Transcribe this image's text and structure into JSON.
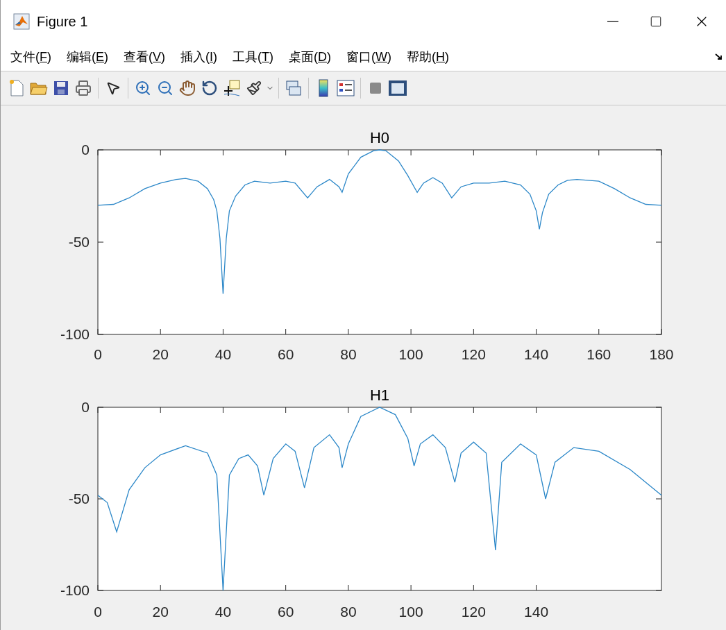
{
  "window": {
    "title": "Figure 1"
  },
  "menu": [
    {
      "label": "文件(",
      "accesskey": "F",
      "close": ")"
    },
    {
      "label": "编辑(",
      "accesskey": "E",
      "close": ")"
    },
    {
      "label": "查看(",
      "accesskey": "V",
      "close": ")"
    },
    {
      "label": "插入(",
      "accesskey": "I",
      "close": ")"
    },
    {
      "label": "工具(",
      "accesskey": "T",
      "close": ")"
    },
    {
      "label": "桌面(",
      "accesskey": "D",
      "close": ")"
    },
    {
      "label": "窗口(",
      "accesskey": "W",
      "close": ")"
    },
    {
      "label": "帮助(",
      "accesskey": "H",
      "close": ")"
    }
  ],
  "plots": [
    {
      "chart_data": {
        "type": "line",
        "title": "H0",
        "xlim": [
          0,
          180
        ],
        "ylim": [
          -100,
          0
        ],
        "xticks": [
          0,
          20,
          40,
          60,
          80,
          100,
          120,
          140,
          160,
          180
        ],
        "yticks": [
          -100,
          -50,
          0
        ],
        "x": [
          0,
          5,
          10,
          15,
          20,
          25,
          28,
          32,
          35,
          37,
          38,
          39,
          40,
          41,
          42,
          44,
          47,
          50,
          55,
          60,
          63,
          67,
          70,
          74,
          77,
          78,
          80,
          84,
          88,
          90,
          92,
          96,
          99,
          102,
          104,
          107,
          110,
          113,
          116,
          120,
          125,
          130,
          135,
          138,
          140,
          141,
          142,
          144,
          147,
          150,
          153,
          160,
          165,
          170,
          175,
          180
        ],
        "series": [
          {
            "color": "#2b87c8",
            "values": [
              -30,
              -29.5,
              -26,
              -21,
              -18,
              -16,
              -15.5,
              -17,
              -21,
              -27,
              -33,
              -48,
              -78,
              -48,
              -33,
              -25,
              -19,
              -17,
              -18,
              -17,
              -18,
              -26,
              -20,
              -16,
              -20,
              -23,
              -13,
              -4,
              -0.5,
              0,
              -0.5,
              -6,
              -14,
              -23,
              -18,
              -15,
              -18,
              -26,
              -20,
              -18,
              -18,
              -17,
              -19,
              -24,
              -33,
              -43,
              -34,
              -24,
              -19,
              -16.5,
              -16,
              -17,
              -21,
              -26,
              -29.5,
              -30
            ]
          }
        ]
      }
    },
    {
      "chart_data": {
        "type": "line",
        "title": "H1",
        "xlim": [
          0,
          180
        ],
        "ylim": [
          -100,
          0
        ],
        "xticks": [
          0,
          20,
          40,
          60,
          80,
          100,
          120,
          140
        ],
        "yticks": [
          -100,
          -50,
          0
        ],
        "x": [
          0,
          3,
          6,
          10,
          15,
          20,
          28,
          35,
          38,
          40,
          42,
          45,
          48,
          51,
          53,
          56,
          60,
          63,
          66,
          69,
          74,
          77,
          78,
          80,
          84,
          90,
          95,
          99,
          101,
          103,
          107,
          111,
          114,
          116,
          120,
          124,
          127,
          129,
          135,
          140,
          143,
          146,
          152,
          160,
          170,
          180
        ],
        "series": [
          {
            "color": "#2b87c8",
            "values": [
              -48,
              -52,
              -68,
              -45,
              -33,
              -26,
              -21,
              -25,
              -37,
              -100,
              -37,
              -28,
              -26,
              -32,
              -48,
              -28,
              -20,
              -24,
              -44,
              -22,
              -15,
              -22,
              -33,
              -20,
              -5,
              0,
              -4,
              -17,
              -32,
              -20,
              -15,
              -22,
              -41,
              -25,
              -19,
              -25,
              -78,
              -30,
              -20,
              -26,
              -50,
              -30,
              -22,
              -24,
              -34,
              -48
            ]
          }
        ]
      }
    }
  ]
}
